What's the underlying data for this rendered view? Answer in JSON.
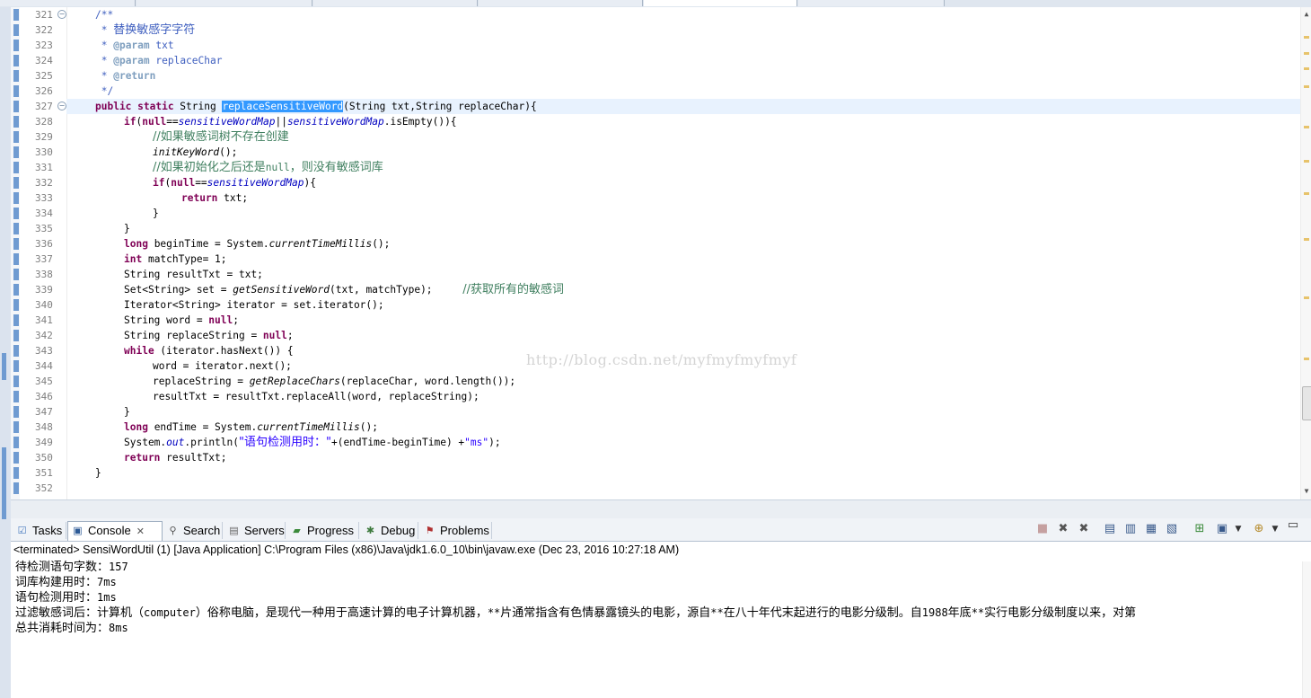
{
  "editor": {
    "line_numbers": [
      "321",
      "322",
      "323",
      "324",
      "325",
      "326",
      "327",
      "328",
      "329",
      "330",
      "331",
      "332",
      "333",
      "334",
      "335",
      "336",
      "337",
      "338",
      "339",
      "340",
      "341",
      "342",
      "343",
      "344",
      "345",
      "346",
      "347",
      "348",
      "349",
      "350",
      "351",
      "352"
    ],
    "code": {
      "l321": "/**",
      "l322_prefix": " * ",
      "l322_text": "替换敏感字字符",
      "l323_prefix": " * ",
      "l323_tag": "@param",
      "l323_rest": " txt",
      "l324_prefix": " * ",
      "l324_tag": "@param",
      "l324_rest": " replaceChar",
      "l325_prefix": " * ",
      "l325_tag": "@return",
      "l326": " */",
      "l327_kw": "public static",
      "l327_a": " String ",
      "l327_sel": "replaceSensitiveWord",
      "l327_b": "(String txt,String replaceChar){",
      "l328_kw1": "if",
      "l328_a": "(",
      "l328_kw2": "null",
      "l328_b": "==",
      "l328_f1": "sensitiveWordMap",
      "l328_c": "||",
      "l328_f2": "sensitiveWordMap",
      "l328_d": ".isEmpty()){",
      "l329": "//如果敏感词树不存在创建",
      "l330_m": "initKeyWord",
      "l330_a": "();",
      "l331_a": "//如果初始化之后还是",
      "l331_b": "null",
      "l331_c": "，则没有敏感词库",
      "l332_kw1": "if",
      "l332_a": "(",
      "l332_kw2": "null",
      "l332_b": "==",
      "l332_f": "sensitiveWordMap",
      "l332_c": "){",
      "l333_kw": "return",
      "l333_a": " txt;",
      "l334": "}",
      "l335": "}",
      "l336_kw": "long",
      "l336_a": " beginTime = System.",
      "l336_m": "currentTimeMillis",
      "l336_b": "();",
      "l337_kw": "int",
      "l337_a": " matchType= 1;",
      "l338": "String resultTxt = txt;",
      "l339_a": "Set<String> set = ",
      "l339_m": "getSensitiveWord",
      "l339_b": "(txt, matchType);     ",
      "l339_c": "//获取所有的敏感词",
      "l340": "Iterator<String> iterator = set.iterator();",
      "l341_a": "String word = ",
      "l341_kw": "null",
      "l341_b": ";",
      "l342_a": "String replaceString = ",
      "l342_kw": "null",
      "l342_b": ";",
      "l343_kw": "while",
      "l343_a": " (iterator.hasNext()) {",
      "l344": "word = iterator.next();",
      "l345_a": "replaceString = ",
      "l345_m": "getReplaceChars",
      "l345_b": "(replaceChar, word.length());",
      "l346": "resultTxt = resultTxt.replaceAll(word, replaceString);",
      "l347": "}",
      "l348_kw": "long",
      "l348_a": " endTime = System.",
      "l348_m": "currentTimeMillis",
      "l348_b": "();",
      "l349_a": "System.",
      "l349_f": "out",
      "l349_b": ".println(",
      "l349_s1": "\"语句检测用时：\"",
      "l349_c": "+(endTime-beginTime) +",
      "l349_s2": "\"ms\"",
      "l349_d": ");",
      "l350_kw": "return",
      "l350_a": " resultTxt;",
      "l351": "}"
    },
    "watermark": "http://blog.csdn.net/myfmyfmyfmyf"
  },
  "views": {
    "tabs": [
      {
        "label": "Tasks",
        "icon": "tasks-icon"
      },
      {
        "label": "Console",
        "icon": "console-icon"
      },
      {
        "label": "Search",
        "icon": "search-icon"
      },
      {
        "label": "Servers",
        "icon": "servers-icon"
      },
      {
        "label": "Progress",
        "icon": "progress-icon"
      },
      {
        "label": "Debug",
        "icon": "debug-icon"
      },
      {
        "label": "Problems",
        "icon": "problems-icon"
      }
    ],
    "close_glyph": "✕"
  },
  "console": {
    "status_line": "<terminated> SensiWordUtil (1) [Java Application] C:\\Program Files (x86)\\Java\\jdk1.6.0_10\\bin\\javaw.exe (Dec 23, 2016 10:27:18 AM)",
    "out1_label": "待检测语句字数：",
    "out1_value": "157",
    "out2_label": "词库构建用时：",
    "out2_value": "7ms",
    "out3_label": "语句检测用时：",
    "out3_value": "1ms",
    "out4_a": "过滤敏感词后：计算机（",
    "out4_b": "computer",
    "out4_c": "）俗称电脑，是现代一种用于高速计算的电子计算机器，",
    "out4_d": "**",
    "out4_e": "片通常指含有色情暴露镜头的电影，源自",
    "out4_f": "**",
    "out4_g": "在八十年代末起进行的电影分级制。自",
    "out4_h": "1988",
    "out4_i": "年底",
    "out4_j": "**",
    "out4_k": "实行电影分级制度以来，对第",
    "out5_label": "总共消耗时间为：",
    "out5_value": "8ms"
  },
  "colors": {
    "keyword": "#7f0055",
    "javadoc": "#3f5fbf",
    "comment": "#3f7f5f",
    "field": "#0000c0",
    "string": "#2a00ff",
    "selection": "#3399ff",
    "current_line": "#e8f2fe"
  }
}
